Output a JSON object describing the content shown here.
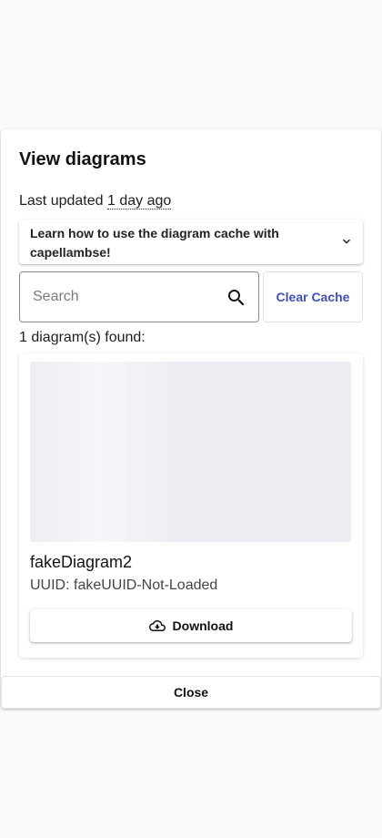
{
  "dialog": {
    "title": "View diagrams",
    "updated_prefix": "Last updated",
    "updated_relative": "1 day ago",
    "help_accordion_label": "Learn how to use the diagram cache with capellambse!",
    "search": {
      "placeholder": "Search",
      "value": ""
    },
    "clear_cache_label": "Clear Cache",
    "found_text": "1 diagram(s) found:",
    "close_label": "Close"
  },
  "diagrams": [
    {
      "name": "fakeDiagram2",
      "uuid_text": "UUID: fakeUUID-Not-Loaded",
      "download_label": "Download"
    }
  ],
  "icons": {
    "accordion": "chevron-down-icon",
    "search": "search-icon",
    "download": "cloud-download-icon"
  },
  "colors": {
    "accent": "#3f51b5",
    "placeholder_thumb": "#eceef3"
  }
}
